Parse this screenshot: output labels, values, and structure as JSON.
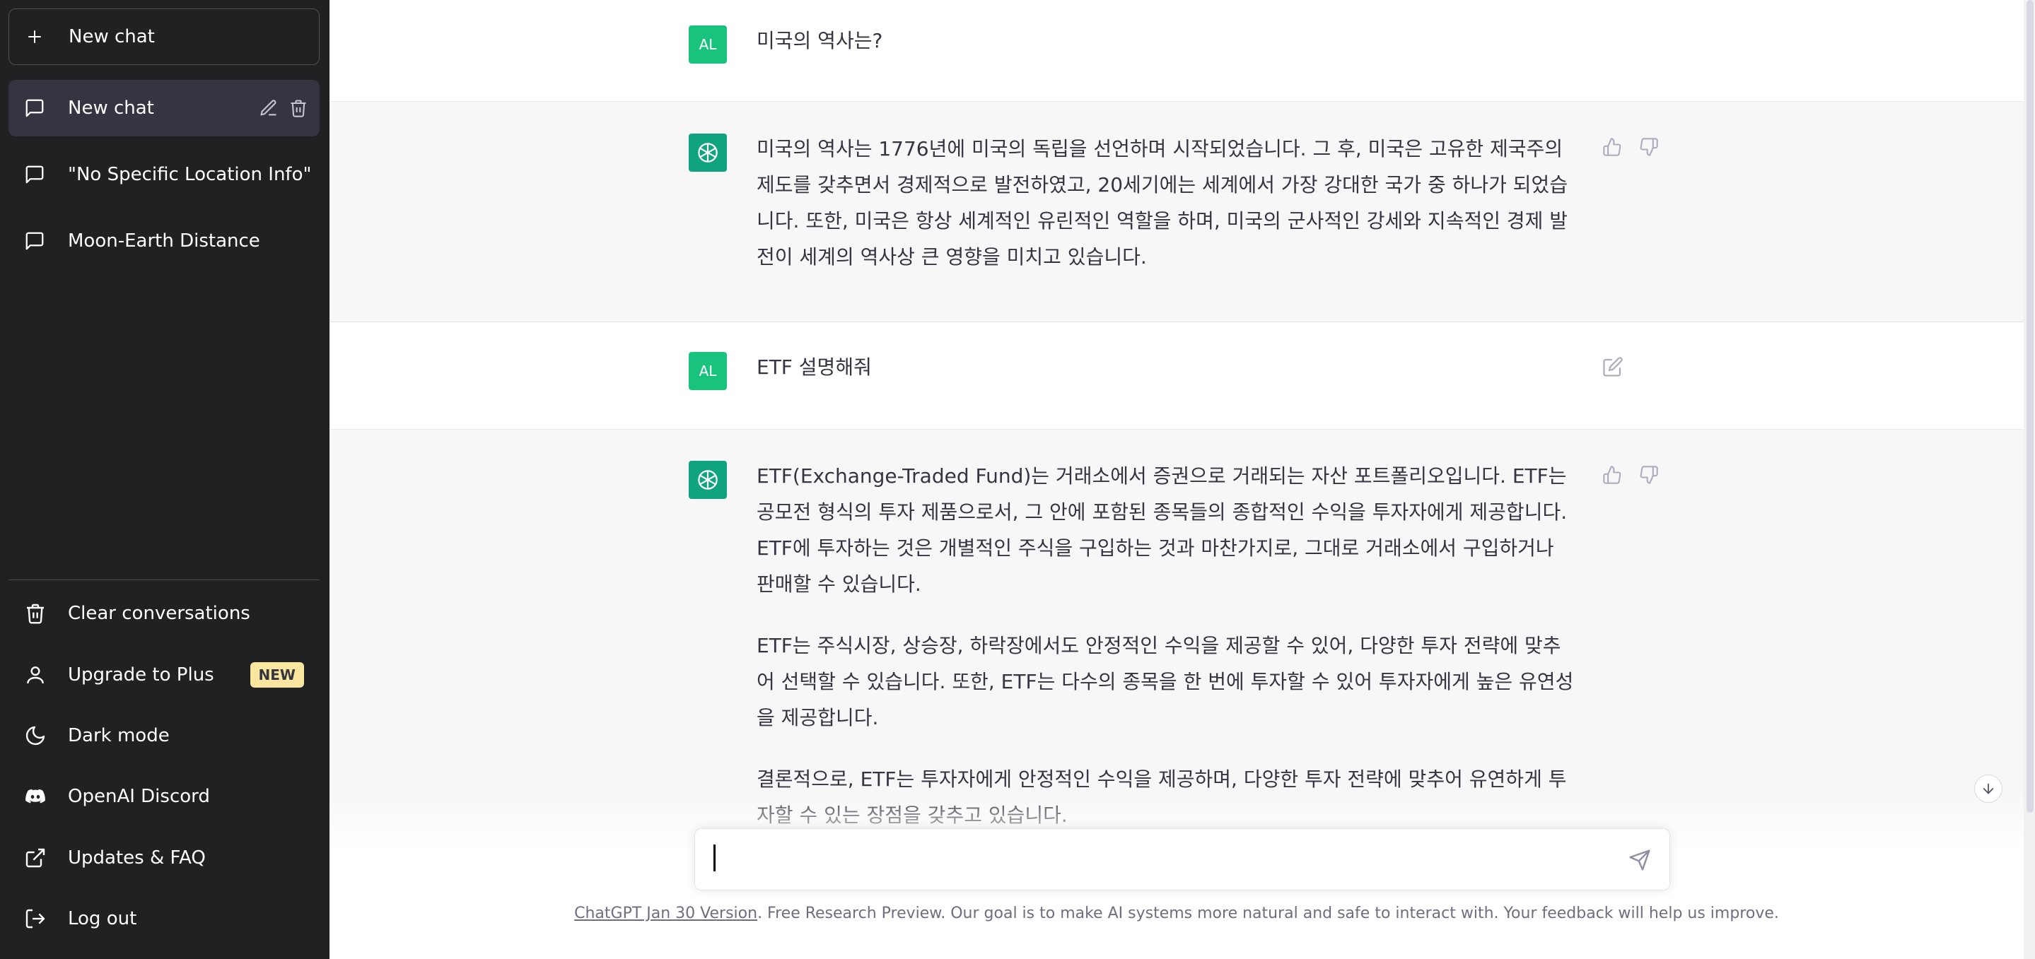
{
  "sidebar": {
    "new_chat_label": "New chat",
    "conversations": [
      {
        "title": "New chat",
        "active": true
      },
      {
        "title": "\"No Specific Location Info\"",
        "active": false
      },
      {
        "title": "Moon-Earth Distance",
        "active": false
      }
    ],
    "menu": [
      {
        "label": "Clear conversations",
        "icon": "trash-icon"
      },
      {
        "label": "Upgrade to Plus",
        "icon": "user-icon",
        "badge": "NEW"
      },
      {
        "label": "Dark mode",
        "icon": "moon-icon"
      },
      {
        "label": "OpenAI Discord",
        "icon": "discord-icon"
      },
      {
        "label": "Updates & FAQ",
        "icon": "external-link-icon"
      },
      {
        "label": "Log out",
        "icon": "logout-icon"
      }
    ]
  },
  "messages": [
    {
      "role": "user",
      "avatar": "AL",
      "text": "미국의 역사는?"
    },
    {
      "role": "assistant",
      "paragraphs": [
        "미국의 역사는 1776년에 미국의 독립을 선언하며 시작되었습니다. 그 후, 미국은 고유한 제국주의 제도를 갖추면서 경제적으로 발전하였고, 20세기에는 세계에서 가장 강대한 국가 중 하나가 되었습니다. 또한, 미국은 항상 세계적인 유린적인 역할을 하며, 미국의 군사적인 강세와 지속적인 경제 발전이 세계의 역사상 큰 영향을 미치고 있습니다."
      ]
    },
    {
      "role": "user",
      "avatar": "AL",
      "text": "ETF 설명해줘"
    },
    {
      "role": "assistant",
      "paragraphs": [
        "ETF(Exchange-Traded Fund)는 거래소에서 증권으로 거래되는 자산 포트폴리오입니다. ETF는 공모전 형식의 투자 제품으로서, 그 안에 포함된 종목들의 종합적인 수익을 투자자에게 제공합니다. ETF에 투자하는 것은 개별적인 주식을 구입하는 것과 마찬가지로, 그대로 거래소에서 구입하거나 판매할 수 있습니다.",
        "ETF는 주식시장, 상승장, 하락장에서도 안정적인 수익을 제공할 수 있어, 다양한 투자 전략에 맞추어 선택할 수 있습니다. 또한, ETF는 다수의 종목을 한 번에 투자할 수 있어 투자자에게 높은 유연성을 제공합니다.",
        "결론적으로, ETF는 투자자에게 안정적인 수익을 제공하며, 다양한 투자 전략에 맞추어 유연하게 투자할 수 있는 장점을 갖추고 있습니다."
      ]
    }
  ],
  "input": {
    "placeholder": "",
    "value": ""
  },
  "footer": {
    "version_link": "ChatGPT Jan 30 Version",
    "text": ". Free Research Preview. Our goal is to make AI systems more natural and safe to interact with. Your feedback will help us improve."
  },
  "colors": {
    "sidebar_bg": "#202123",
    "user_avatar": "#19c37d",
    "bot_avatar": "#10a37f",
    "badge_bg": "#fae69e"
  }
}
